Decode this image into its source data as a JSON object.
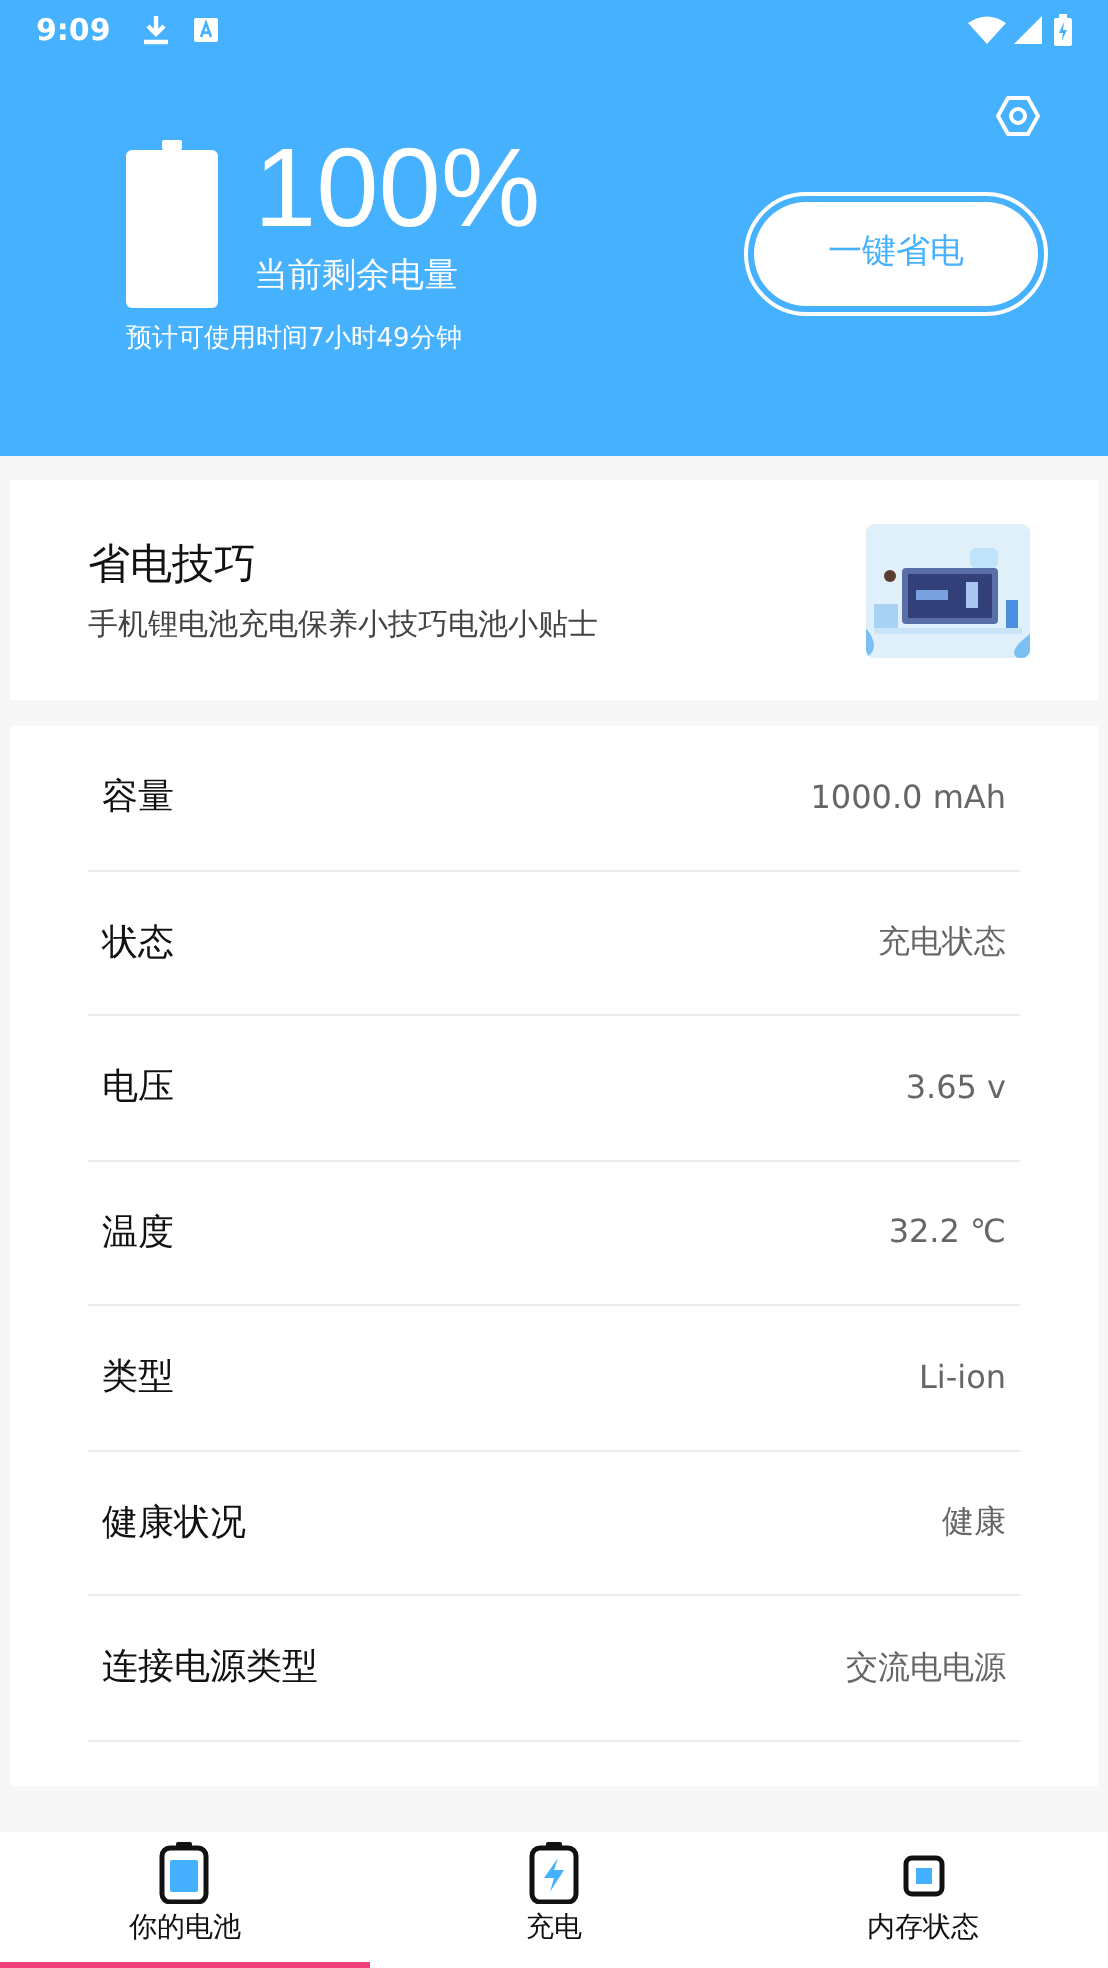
{
  "status_bar": {
    "time": "9:09"
  },
  "header": {
    "percent": "100%",
    "caption": "当前剩余电量",
    "estimate": "预计可使用时间7小时49分钟",
    "save_button": "一键省电"
  },
  "tips_card": {
    "title": "省电技巧",
    "subtitle": "手机锂电池充电保养小技巧电池小贴士"
  },
  "info_rows": [
    {
      "label": "容量",
      "value": "1000.0 mAh"
    },
    {
      "label": "状态",
      "value": "充电状态"
    },
    {
      "label": "电压",
      "value": "3.65 v"
    },
    {
      "label": "温度",
      "value": "32.2 ℃"
    },
    {
      "label": "类型",
      "value": "Li-ion"
    },
    {
      "label": "健康状况",
      "value": "健康"
    },
    {
      "label": "连接电源类型",
      "value": "交流电电源"
    }
  ],
  "bottom_tabs": [
    {
      "label": "你的电池",
      "kind": "battery",
      "selected": true
    },
    {
      "label": "充电",
      "kind": "charging",
      "selected": false
    },
    {
      "label": "内存状态",
      "kind": "memory",
      "selected": false
    }
  ]
}
